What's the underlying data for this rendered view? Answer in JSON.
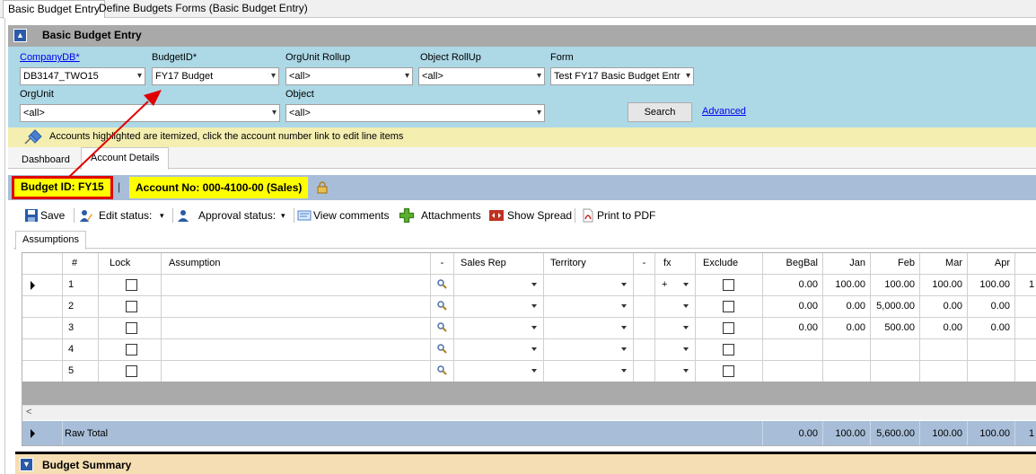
{
  "top_tabs": [
    "Basic Budget Entry",
    "Define Budgets Forms (Basic Budget Entry)"
  ],
  "section_title": "Basic Budget Entry",
  "filters": {
    "company_label": "CompanyDB*",
    "company_value": "DB3147_TWO15",
    "budget_label": "BudgetID*",
    "budget_value": "FY17 Budget",
    "orgunit_rollup_label": "OrgUnit Rollup",
    "orgunit_rollup_value": "<all>",
    "object_rollup_label": "Object RollUp",
    "object_rollup_value": "<all>",
    "form_label": "Form",
    "form_value": "Test FY17 Basic Budget Entr",
    "orgunit_label": "OrgUnit",
    "orgunit_value": "<all>",
    "object_label": "Object",
    "object_value": "<all>",
    "search_label": "Search",
    "advanced_label": "Advanced"
  },
  "notice": "Accounts highlighted are itemized, click the account number link to edit line items",
  "sub_tabs": [
    "Dashboard",
    "Account Details"
  ],
  "budget_id_badge": "Budget ID: FY15",
  "separator": "|",
  "account_badge": "Account No: 000-4100-00 (Sales)",
  "toolbar": {
    "save": "Save",
    "edit_status": "Edit status:",
    "approval_status": "Approval status:",
    "view_comments": "View comments",
    "attachments": "Attachments",
    "show_spread": "Show Spread",
    "print_pdf": "Print to PDF"
  },
  "assumptions_tab": "Assumptions",
  "grid": {
    "headers": [
      "#",
      "Lock",
      "Assumption",
      "-",
      "Sales Rep",
      "Territory",
      "-",
      "fx",
      "Exclude",
      "BegBal",
      "Jan",
      "Feb",
      "Mar",
      "Apr"
    ],
    "rows": [
      {
        "num": "1",
        "fx": "+",
        "begbal": "0.00",
        "jan": "100.00",
        "feb": "100.00",
        "mar": "100.00",
        "apr": "100.00",
        "extra": "1"
      },
      {
        "num": "2",
        "fx": "",
        "begbal": "0.00",
        "jan": "0.00",
        "feb": "5,000.00",
        "mar": "0.00",
        "apr": "0.00",
        "extra": ""
      },
      {
        "num": "3",
        "fx": "",
        "begbal": "0.00",
        "jan": "0.00",
        "feb": "500.00",
        "mar": "0.00",
        "apr": "0.00",
        "extra": ""
      },
      {
        "num": "4",
        "fx": "",
        "begbal": "",
        "jan": "",
        "feb": "",
        "mar": "",
        "apr": "",
        "extra": ""
      },
      {
        "num": "5",
        "fx": "",
        "begbal": "",
        "jan": "",
        "feb": "",
        "mar": "",
        "apr": "",
        "extra": ""
      }
    ],
    "scroll_left": "<",
    "total_label": "Raw Total",
    "totals": {
      "begbal": "0.00",
      "jan": "100.00",
      "feb": "5,600.00",
      "mar": "100.00",
      "apr": "100.00",
      "extra": "1"
    }
  },
  "summary_title": "Budget Summary",
  "colors": {
    "highlight_yellow": "#ffff00",
    "annotation_red": "#e00000",
    "panel_blue": "#add8e6"
  },
  "icons": [
    "collapse-up-icon",
    "pushpin-icon",
    "lock-icon",
    "save-icon",
    "edit-status-icon",
    "approval-status-icon",
    "comments-icon",
    "attachments-icon",
    "spread-icon",
    "pdf-icon",
    "magnifier-icon",
    "collapse-down-icon"
  ]
}
